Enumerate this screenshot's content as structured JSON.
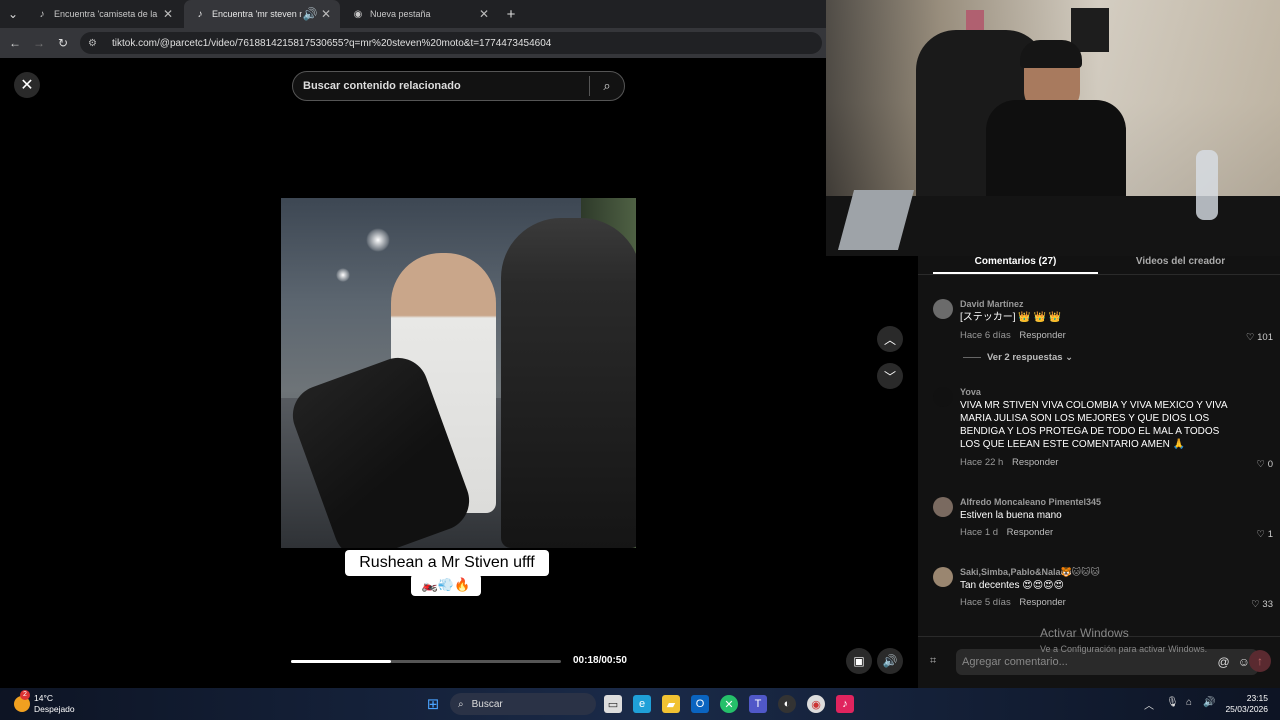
{
  "browser": {
    "tabs": [
      {
        "title": "Encuentra 'camiseta de la selec",
        "icon": "tiktok-icon"
      },
      {
        "title": "Encuentra 'mr steven moto'",
        "icon": "tiktok-icon"
      },
      {
        "title": "Nueva pestaña",
        "icon": "chrome-icon"
      }
    ],
    "url": "tiktok.com/@parcetc1/video/7618814215817530655?q=mr%20steven%20moto&t=1774473454604"
  },
  "viewer": {
    "search_placeholder": "Buscar contenido relacionado",
    "caption_line1": "Rushean a Mr Stiven ufff",
    "caption_line2": "🏍️💨🔥",
    "progress_fraction": 0.37,
    "time": "00:18/00:50"
  },
  "comments_panel": {
    "tabs": [
      "Comentarios (27)",
      "Videos del creador"
    ],
    "comments": [
      {
        "name": "David Martínez",
        "text": "[ステッカー] 👑 👑 👑",
        "time": "Hace 6 días",
        "reply": "Responder",
        "likes": "101",
        "more": "Ver 2 respuestas ⌄"
      },
      {
        "name": "Yova",
        "text": "VIVA MR STIVEN VIVA COLOMBIA Y VIVA MEXICO Y VIVA MARIA JULISA SON LOS MEJORES Y QUE DIOS LOS BENDIGA Y LOS PROTEGA DE TODO EL MAL A TODOS LOS QUE LEEAN ESTE COMENTARIO AMEN 🙏",
        "time": "Hace 22 h",
        "reply": "Responder",
        "likes": "0"
      },
      {
        "name": "Alfredo Moncaleano Pimentel345",
        "text": "Estiven la buena mano",
        "time": "Hace 1 d",
        "reply": "Responder",
        "likes": "1"
      },
      {
        "name": "Saki,Simba,Pablo&Nala🐯🐱🐱🐱",
        "text": "Tan decentes 😍😍😍😍",
        "time": "Hace 5 días",
        "reply": "Responder",
        "likes": "33"
      }
    ],
    "input_placeholder": "Agregar comentario..."
  },
  "watermark": {
    "title": "Activar Windows",
    "subtitle": "Ve a Configuración para activar Windows."
  },
  "taskbar": {
    "weather_temp": "14°C",
    "weather_desc": "Despejado",
    "search_label": "Buscar",
    "time": "23:15",
    "date": "25/03/2026",
    "notification_count": "2"
  }
}
